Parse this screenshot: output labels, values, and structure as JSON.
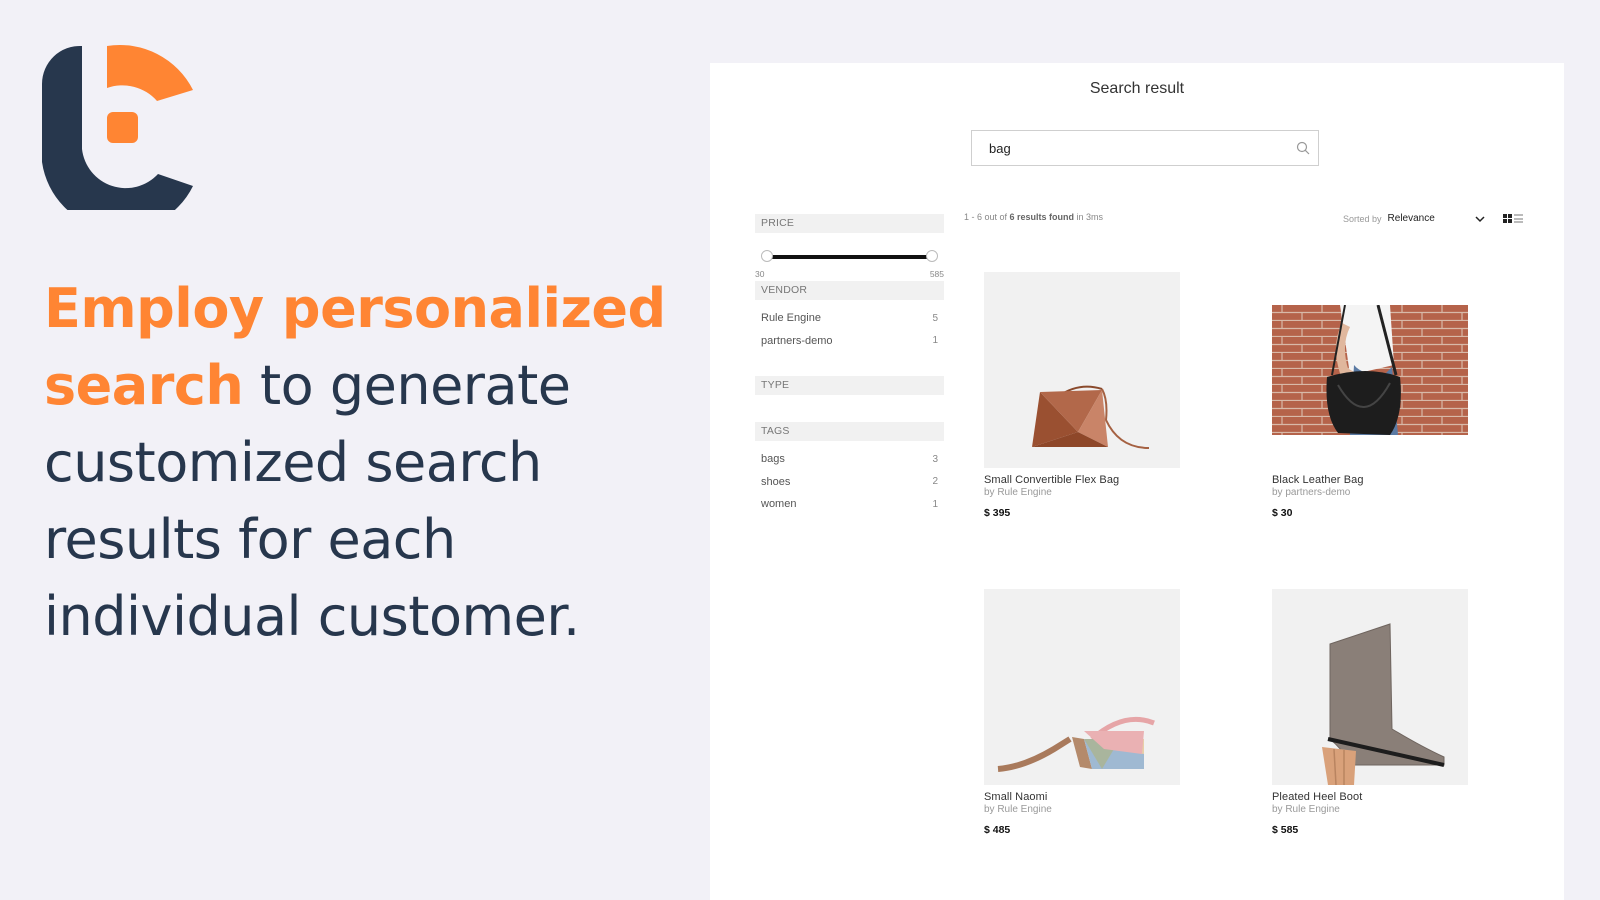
{
  "brand": {
    "logo_icon": "brand-logo-icon",
    "colors": {
      "navy": "#27374d",
      "orange": "#ff8533",
      "background": "#f2f1f7"
    }
  },
  "headline": {
    "accent_text": "Employ personalized search",
    "rest_text": " to generate customized search results for each individual customer."
  },
  "search_panel": {
    "title": "Search result",
    "search": {
      "value": "bag",
      "placeholder": "",
      "icon": "search-icon"
    },
    "results_summary": {
      "prefix": "1 - 6 out of ",
      "count_text": "6 results found",
      "suffix": " in 3ms"
    },
    "sort": {
      "label": "Sorted by",
      "value": "Relevance",
      "icon": "chevron-down-icon"
    },
    "view_modes": [
      {
        "name": "grid",
        "icon": "grid-view-icon",
        "active": true
      },
      {
        "name": "list",
        "icon": "list-view-icon",
        "active": false
      }
    ],
    "filters": {
      "price": {
        "label": "PRICE",
        "min": "30",
        "max": "585",
        "range_selected": [
          30,
          585
        ]
      },
      "vendor": {
        "label": "VENDOR",
        "items": [
          {
            "label": "Rule Engine",
            "count": "5"
          },
          {
            "label": "partners-demo",
            "count": "1"
          }
        ]
      },
      "type": {
        "label": "TYPE",
        "items": []
      },
      "tags": {
        "label": "TAGS",
        "items": [
          {
            "label": "bags",
            "count": "3"
          },
          {
            "label": "shoes",
            "count": "2"
          },
          {
            "label": "women",
            "count": "1"
          }
        ]
      }
    },
    "products": [
      {
        "name": "Small Convertible Flex Bag",
        "vendor": "by Rule Engine",
        "price": "$ 395",
        "image": "brown-triangular-bag"
      },
      {
        "name": "Black Leather Bag",
        "vendor": "by partners-demo",
        "price": "$ 30",
        "image": "black-leather-bag-on-brick-wall"
      },
      {
        "name": "Small Naomi",
        "vendor": "by Rule Engine",
        "price": "$ 485",
        "image": "pastel-color-block-bag"
      },
      {
        "name": "Pleated Heel Boot",
        "vendor": "by Rule Engine",
        "price": "$ 585",
        "image": "taupe-ankle-boot"
      }
    ]
  }
}
